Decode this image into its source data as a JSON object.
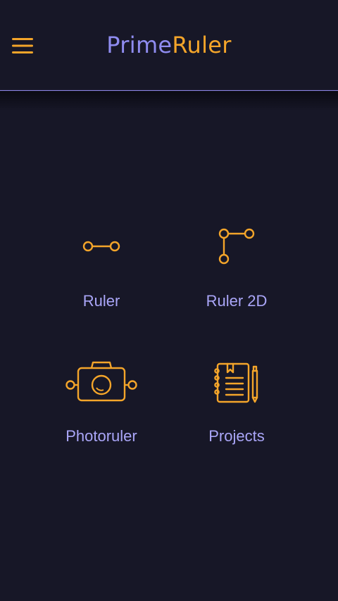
{
  "header": {
    "title_part1": "Prime",
    "title_part2": "Ruler",
    "menu_icon": "hamburger-menu-icon"
  },
  "tiles": [
    {
      "label": "Ruler",
      "icon": "ruler-icon"
    },
    {
      "label": "Ruler 2D",
      "icon": "ruler-2d-icon"
    },
    {
      "label": "Photoruler",
      "icon": "camera-icon"
    },
    {
      "label": "Projects",
      "icon": "notebook-icon"
    }
  ],
  "colors": {
    "background": "#171727",
    "accent_orange": "#f4a52a",
    "accent_purple": "#8f8cf0",
    "label_purple": "#aaa6f8",
    "divider": "#8c85e6"
  }
}
